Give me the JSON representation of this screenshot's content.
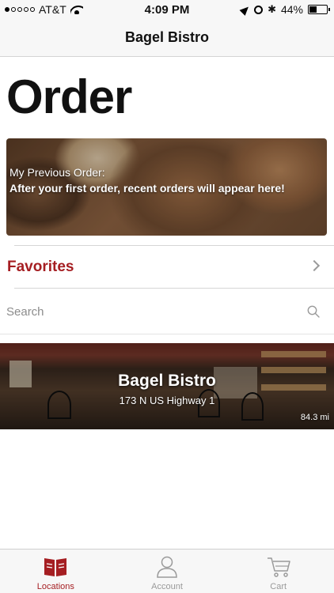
{
  "status_bar": {
    "carrier": "AT&T",
    "time": "4:09 PM",
    "battery": "44%",
    "battery_level": 0.44
  },
  "nav": {
    "title": "Bagel Bistro"
  },
  "page": {
    "title": "Order"
  },
  "previous_order": {
    "label": "My Previous Order:",
    "message": "After your first order, recent orders will appear here!"
  },
  "favorites": {
    "label": "Favorites"
  },
  "search": {
    "placeholder": "Search",
    "value": ""
  },
  "location": {
    "name": "Bagel Bistro",
    "address": "173 N US Highway 1",
    "distance": "84.3 mi"
  },
  "tabs": [
    {
      "label": "Locations",
      "icon": "book-icon",
      "active": true
    },
    {
      "label": "Account",
      "icon": "person-icon",
      "active": false
    },
    {
      "label": "Cart",
      "icon": "cart-icon",
      "active": false
    }
  ],
  "colors": {
    "accent": "#a51e22",
    "inactive": "#9a9a9a"
  }
}
